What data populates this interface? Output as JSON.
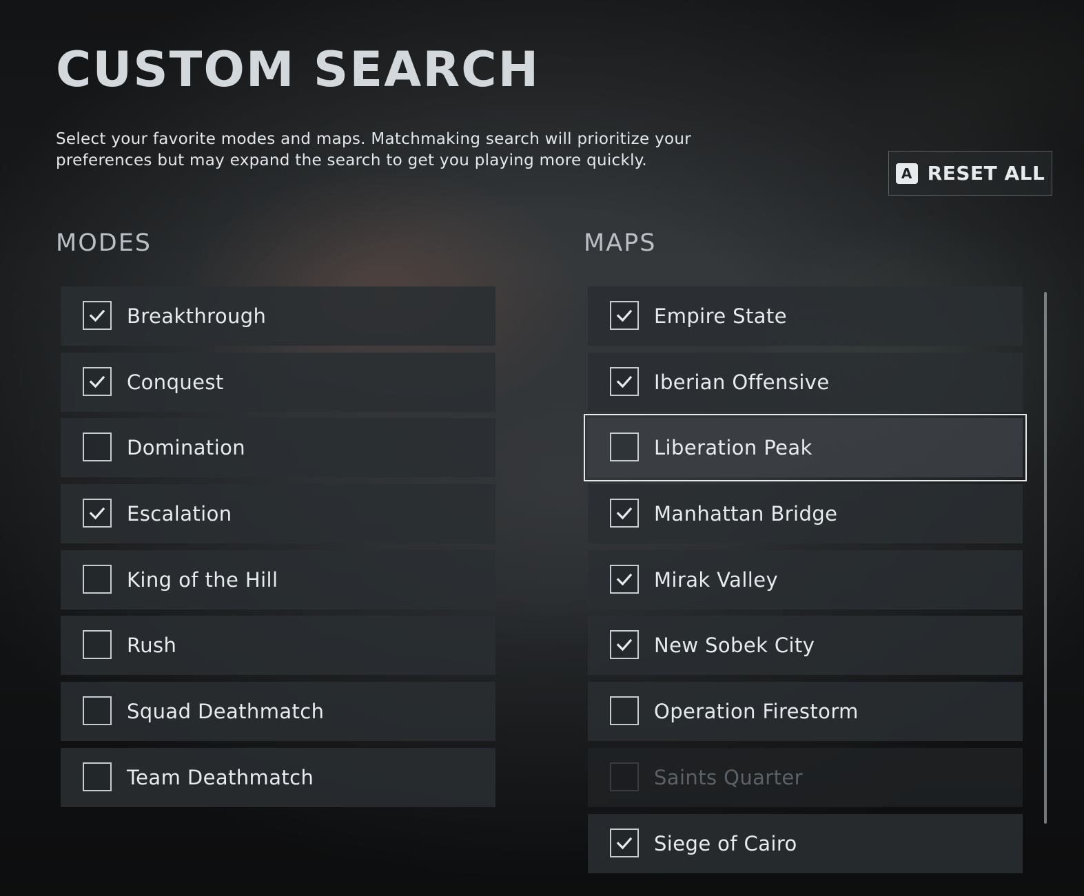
{
  "header": {
    "title": "CUSTOM SEARCH",
    "description": "Select your favorite modes and maps. Matchmaking search will prioritize your preferences but may expand the search to get you playing more quickly."
  },
  "reset": {
    "key": "A",
    "label": "RESET ALL"
  },
  "modes": {
    "heading": "MODES",
    "items": [
      {
        "label": "Breakthrough",
        "checked": true
      },
      {
        "label": "Conquest",
        "checked": true
      },
      {
        "label": "Domination",
        "checked": false
      },
      {
        "label": "Escalation",
        "checked": true
      },
      {
        "label": "King of the Hill",
        "checked": false
      },
      {
        "label": "Rush",
        "checked": false
      },
      {
        "label": "Squad Deathmatch",
        "checked": false
      },
      {
        "label": "Team Deathmatch",
        "checked": false
      }
    ]
  },
  "maps": {
    "heading": "MAPS",
    "items": [
      {
        "label": "Empire State",
        "checked": true
      },
      {
        "label": "Iberian Offensive",
        "checked": true
      },
      {
        "label": "Liberation Peak",
        "checked": false,
        "focused": true
      },
      {
        "label": "Manhattan Bridge",
        "checked": true
      },
      {
        "label": "Mirak Valley",
        "checked": true
      },
      {
        "label": "New Sobek City",
        "checked": true
      },
      {
        "label": "Operation Firestorm",
        "checked": false
      },
      {
        "label": "Saints Quarter",
        "checked": false,
        "disabled": true
      },
      {
        "label": "Siege of Cairo",
        "checked": true
      }
    ]
  },
  "icons": {
    "check": "check-icon",
    "reset_key": "a-button-icon"
  }
}
